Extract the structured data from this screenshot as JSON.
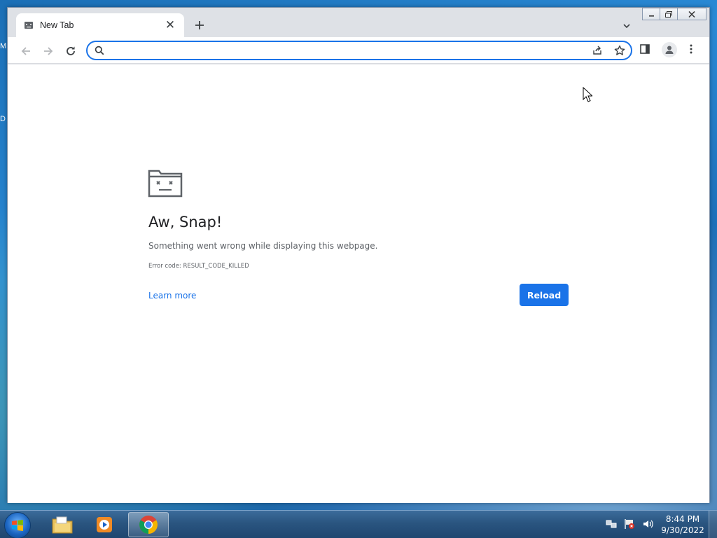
{
  "window": {
    "controls": [
      "minimize",
      "maximize",
      "close"
    ]
  },
  "tabs": [
    {
      "title": "New Tab",
      "favicon": "sad-tab-icon",
      "active": true
    }
  ],
  "toolbar": {
    "back_icon": "back-arrow-icon",
    "forward_icon": "forward-arrow-icon",
    "reload_icon": "reload-icon",
    "omnibox": {
      "value": "",
      "placeholder": ""
    }
  },
  "error_page": {
    "heading": "Aw, Snap!",
    "message": "Something went wrong while displaying this webpage.",
    "error_code": "Error code: RESULT_CODE_KILLED",
    "learn_more": "Learn more",
    "reload_button": "Reload"
  },
  "desktop": {
    "edge_labels": [
      "M",
      "D"
    ]
  },
  "taskbar": {
    "apps": [
      {
        "name": "windows-explorer",
        "active": false
      },
      {
        "name": "windows-media-player",
        "active": false
      },
      {
        "name": "google-chrome",
        "active": true
      }
    ],
    "clock": {
      "time": "8:44 PM",
      "date": "9/30/2022"
    }
  },
  "colors": {
    "accent": "#1a73e8",
    "tab_strip": "#dee1e6",
    "taskbar": "#2a5580"
  }
}
